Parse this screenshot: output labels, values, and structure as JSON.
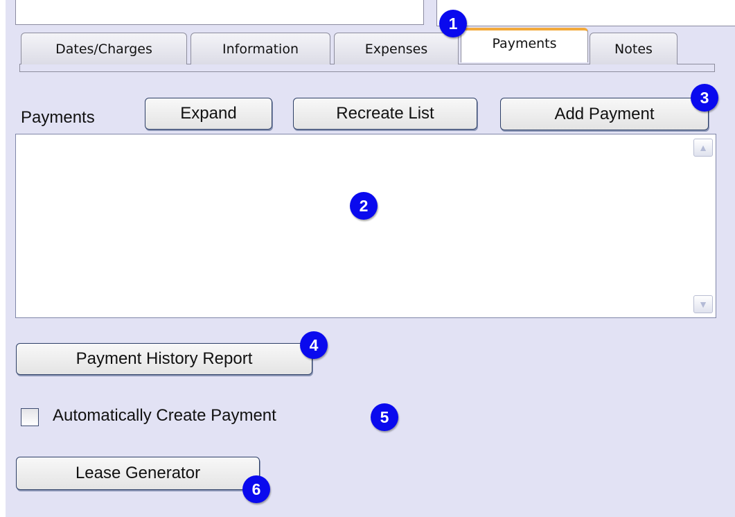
{
  "tabs": [
    {
      "label": "Dates/Charges",
      "active": false
    },
    {
      "label": "Information",
      "active": false
    },
    {
      "label": "Expenses",
      "active": false
    },
    {
      "label": "Payments",
      "active": true
    },
    {
      "label": "Notes",
      "active": false
    }
  ],
  "payments": {
    "section_label": "Payments",
    "expand_label": "Expand",
    "recreate_label": "Recreate List",
    "add_label": "Add Payment"
  },
  "buttons": {
    "history_label": "Payment History Report",
    "lease_label": "Lease Generator"
  },
  "auto_create": {
    "label": "Automatically Create Payment",
    "checked": false
  },
  "markers": [
    "1",
    "2",
    "3",
    "4",
    "5",
    "6"
  ],
  "colors": {
    "background": "#e2e2f4",
    "marker": "#0a0aee",
    "active_tab_accent": "#f2a93b"
  }
}
